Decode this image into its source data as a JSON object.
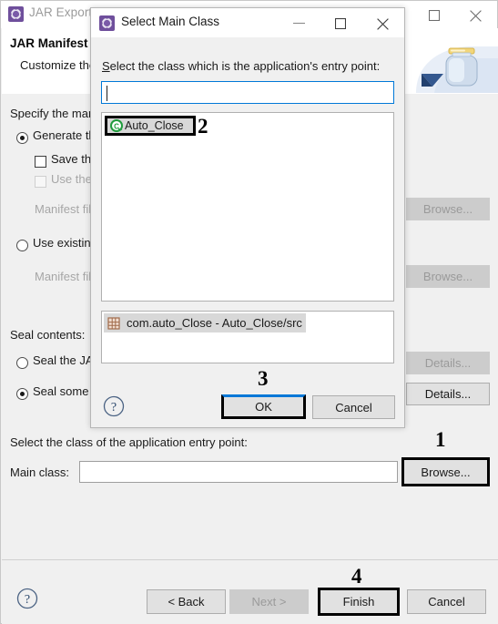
{
  "wizard": {
    "title": "JAR Export",
    "title_icon": "eclipse-gear-icon",
    "header_title": "JAR Manifest Specification",
    "header_subtitle": "Customize the manifest file for the JAR file.",
    "manifest_section_label": "Specify the manifest:",
    "generate_manifest_label": "Generate the manifest file",
    "save_manifest_label": "Save the manifest in the workspace",
    "use_manifest_label": "Use the saved manifest in the generated JAR",
    "manifest_file_label_1": "Manifest file:",
    "use_existing_label": "Use existing manifest from workspace",
    "manifest_file_label_2": "Manifest file:",
    "browse_1_label": "Browse...",
    "browse_2_label": "Browse...",
    "seal_section_label": "Seal contents:",
    "seal_jar_label": "Seal the JAR",
    "seal_some_label": "Seal some packages",
    "details_1_label": "Details...",
    "details_2_label": "Details...",
    "entry_point_label": "Select the class of the application entry point:",
    "main_class_label": "Main class:",
    "main_class_value": "",
    "main_class_browse_label": "Browse...",
    "footer": {
      "help_icon": "question-mark-icon",
      "back_label": "< Back",
      "next_label": "Next >",
      "finish_label": "Finish",
      "cancel_label": "Cancel"
    },
    "window_buttons": {
      "maximize_icon": "maximize-icon",
      "close_icon": "close-icon"
    }
  },
  "dialog": {
    "title": "Select Main Class",
    "title_icon": "eclipse-gear-icon",
    "window_buttons": {
      "minimize_icon": "minimize-icon",
      "maximize_icon": "maximize-icon",
      "close_icon": "close-icon"
    },
    "prompt_first_letter": "S",
    "prompt_rest": "elect the class which is the application's entry point:",
    "filter_value": "",
    "matches": [
      {
        "label": "Auto_Close",
        "icon": "java-class-icon"
      }
    ],
    "qualifiers": [
      {
        "label": "com.auto_Close - Auto_Close/src",
        "icon": "package-icon"
      }
    ],
    "help_icon": "question-mark-icon",
    "ok_label": "OK",
    "cancel_label": "Cancel"
  },
  "annotations": [
    {
      "number": "1",
      "target": "main-class-browse-button"
    },
    {
      "number": "2",
      "target": "matches-list-item"
    },
    {
      "number": "3",
      "target": "dialog-ok-button"
    },
    {
      "number": "4",
      "target": "wizard-finish-button"
    }
  ],
  "colors": {
    "accent": "#0078d7",
    "window_bg": "#f0f0f0",
    "annotation": "#000000",
    "selection": "#d8d8d8"
  }
}
